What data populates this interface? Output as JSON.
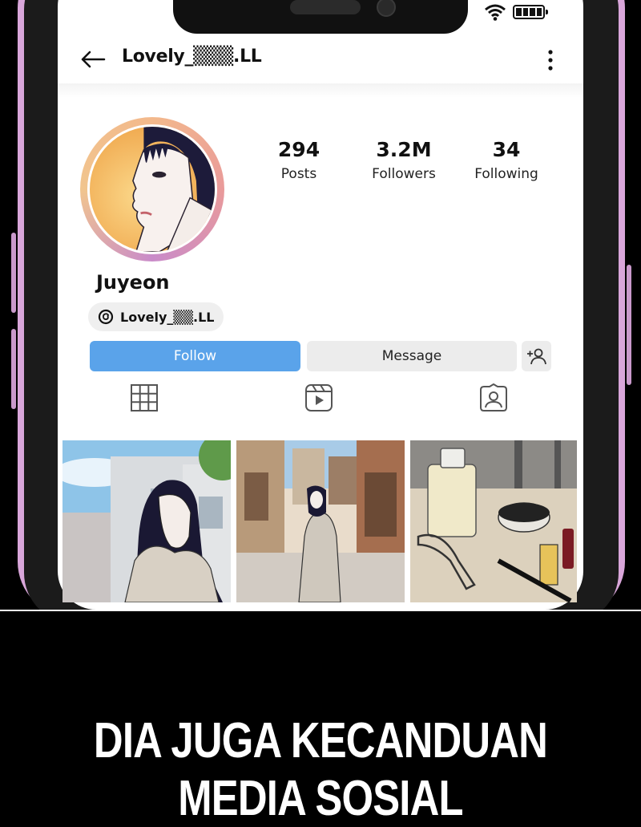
{
  "profile": {
    "username": "Lovely_▒▒▒.LL",
    "display_name": "Juyeon",
    "threads_handle": "Lovely_▒▒.LL",
    "stats": [
      {
        "value": "294",
        "label": "Posts"
      },
      {
        "value": "3.2M",
        "label": "Followers"
      },
      {
        "value": "34",
        "label": "Following"
      }
    ]
  },
  "actions": {
    "follow_label": "Follow",
    "message_label": "Message"
  },
  "icons": {
    "back": "arrow-left-icon",
    "menu": "kebab-icon",
    "threads": "threads-icon",
    "add_user": "add-user-icon",
    "tabs": [
      "grid-icon",
      "reels-icon",
      "tagged-icon"
    ]
  },
  "colors": {
    "follow_button": "#5aa3ea",
    "frame": "#d9a6da",
    "avatar_ring": "#e99a9a"
  },
  "caption": {
    "line1": "DIA JUGA KECANDUAN",
    "line2": "MEDIA SOSIAL"
  }
}
